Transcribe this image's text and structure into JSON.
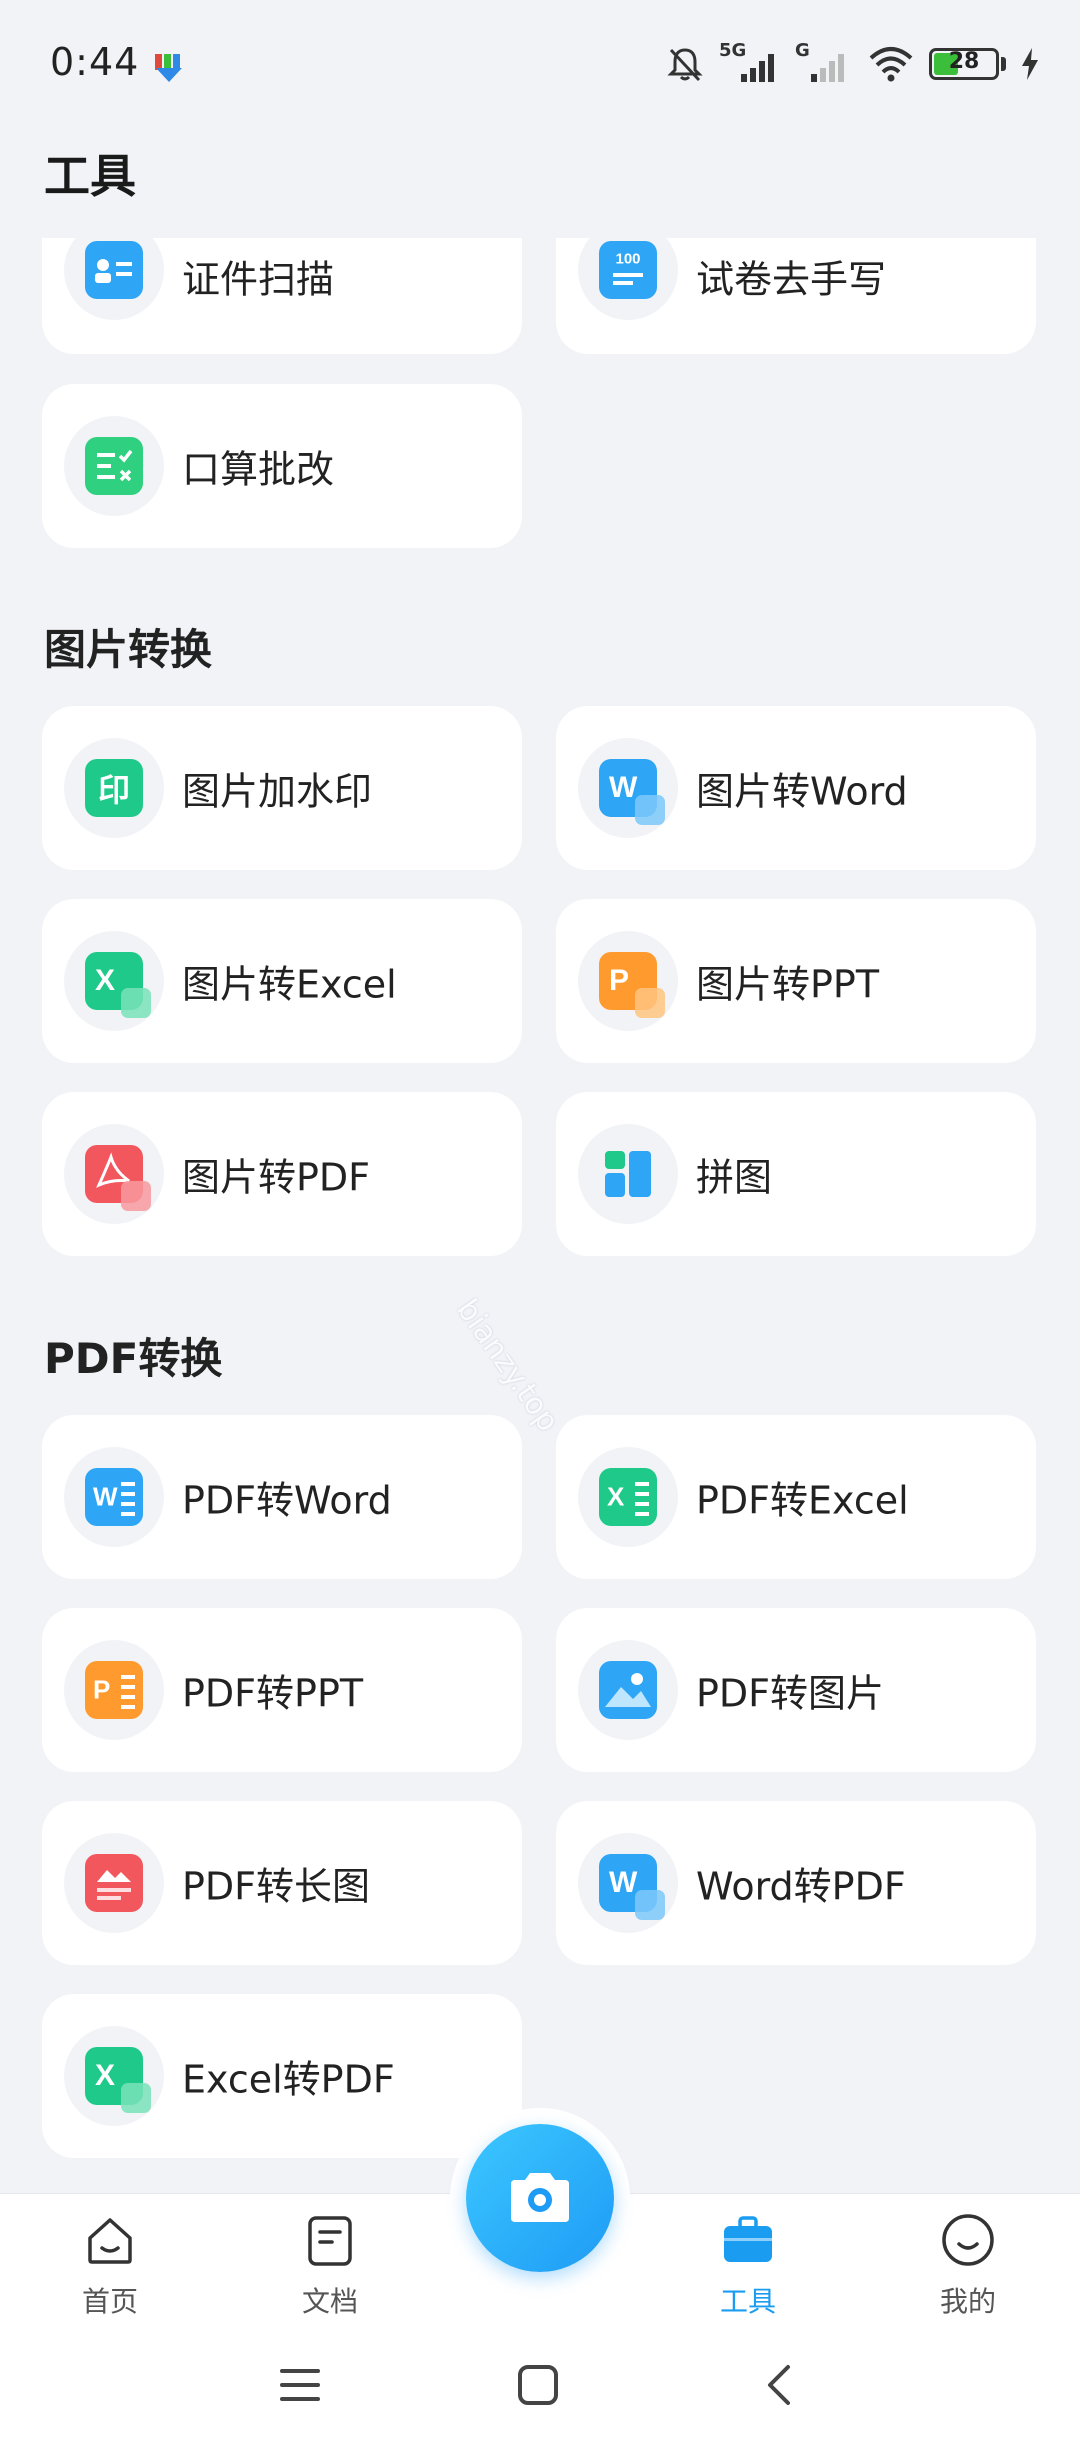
{
  "status": {
    "time": "0:44",
    "network": "5G",
    "network2": "G",
    "battery": "28"
  },
  "page": {
    "title": "工具"
  },
  "top_cards": [
    {
      "label": "证件扫描",
      "icon": "id-card-icon"
    },
    {
      "label": "试卷去手写",
      "icon": "exam-paper-icon",
      "icon_text": "100"
    },
    {
      "label": "口算批改",
      "icon": "math-check-icon"
    }
  ],
  "sections": [
    {
      "title": "图片转换",
      "items": [
        {
          "label": "图片加水印",
          "icon": "watermark-icon",
          "icon_text": "印"
        },
        {
          "label": "图片转Word",
          "icon": "word-icon",
          "icon_text": "W"
        },
        {
          "label": "图片转Excel",
          "icon": "excel-icon",
          "icon_text": "X"
        },
        {
          "label": "图片转PPT",
          "icon": "ppt-icon",
          "icon_text": "P"
        },
        {
          "label": "图片转PDF",
          "icon": "pdf-icon"
        },
        {
          "label": "拼图",
          "icon": "collage-icon"
        }
      ]
    },
    {
      "title": "PDF转换",
      "items": [
        {
          "label": "PDF转Word",
          "icon": "word-doc-icon",
          "icon_text": "W"
        },
        {
          "label": "PDF转Excel",
          "icon": "excel-doc-icon",
          "icon_text": "X"
        },
        {
          "label": "PDF转PPT",
          "icon": "ppt-doc-icon",
          "icon_text": "P"
        },
        {
          "label": "PDF转图片",
          "icon": "image-icon"
        },
        {
          "label": "PDF转长图",
          "icon": "long-image-icon"
        },
        {
          "label": "Word转PDF",
          "icon": "word-to-pdf-icon",
          "icon_text": "W"
        },
        {
          "label": "Excel转PDF",
          "icon": "excel-to-pdf-icon",
          "icon_text": "X"
        }
      ]
    }
  ],
  "watermark": "bianzy.top",
  "nav": [
    {
      "label": "首页",
      "icon": "home-icon"
    },
    {
      "label": "文档",
      "icon": "document-icon"
    },
    {
      "label": "工具",
      "icon": "toolbox-icon",
      "active": true
    },
    {
      "label": "我的",
      "icon": "profile-icon"
    }
  ],
  "colors": {
    "accent": "#1a9cf0",
    "background": "#f2f3f7",
    "card": "#ffffff",
    "green": "#1fc98a",
    "blue": "#2ea6f5",
    "orange": "#ff9b2e",
    "red": "#f2575e"
  }
}
